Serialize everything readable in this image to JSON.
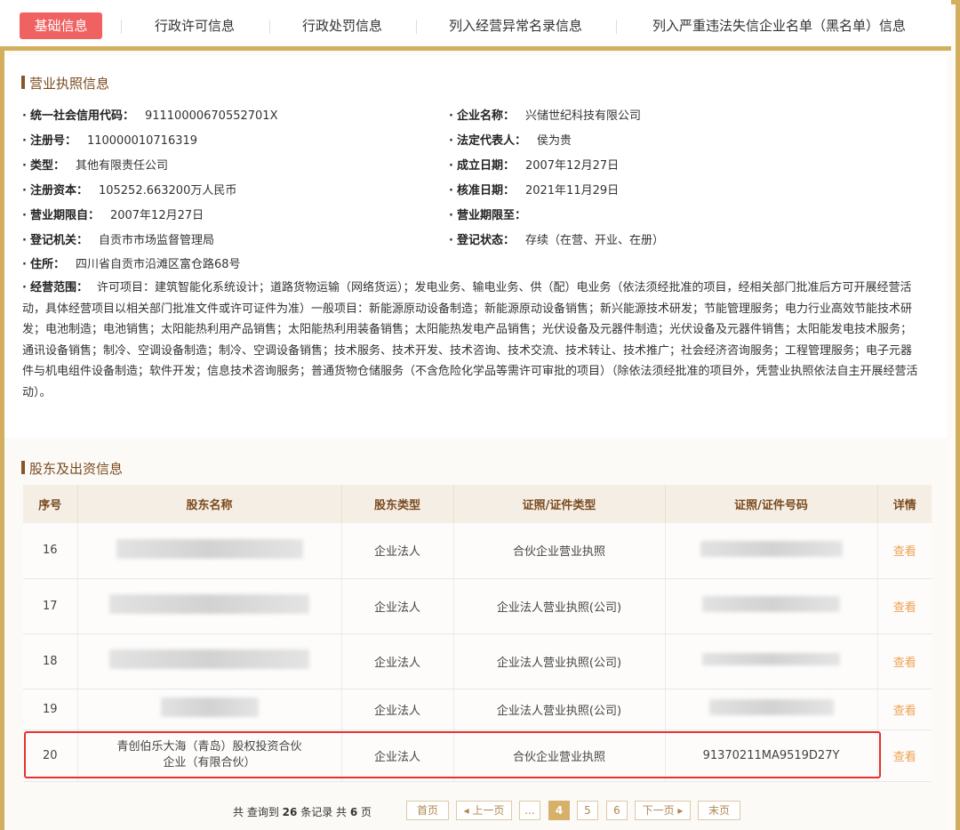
{
  "tabs": [
    {
      "label": "基础信息",
      "active": true
    },
    {
      "label": "行政许可信息"
    },
    {
      "label": "行政处罚信息"
    },
    {
      "label": "列入经营异常名录信息"
    },
    {
      "label": "列入严重违法失信企业名单（黑名单）信息"
    }
  ],
  "license": {
    "title": "营业执照信息",
    "dot": "·",
    "credit_code": {
      "label": "统一社会信用代码：",
      "value": "91110000670552701X"
    },
    "company_name": {
      "label": "企业名称：",
      "value": "兴储世纪科技有限公司"
    },
    "reg_no": {
      "label": "注册号：",
      "value": "110000010716319"
    },
    "legal_rep": {
      "label": "法定代表人：",
      "value": "侯为贵"
    },
    "type": {
      "label": "类型：",
      "value": "其他有限责任公司"
    },
    "founded": {
      "label": "成立日期：",
      "value": "2007年12月27日"
    },
    "capital": {
      "label": "注册资本：",
      "value": "105252.663200万人民币"
    },
    "approved": {
      "label": "核准日期：",
      "value": "2021年11月29日"
    },
    "term_from": {
      "label": "营业期限自：",
      "value": "2007年12月27日"
    },
    "term_to": {
      "label": "营业期限至：",
      "value": ""
    },
    "authority": {
      "label": "登记机关：",
      "value": "自贡市市场监督管理局"
    },
    "status": {
      "label": "登记状态：",
      "value": "存续（在营、开业、在册）"
    },
    "address": {
      "label": "住所：",
      "value": "四川省自贡市沿滩区富仓路68号"
    },
    "scope": {
      "label": "经营范围：",
      "value": "许可项目：建筑智能化系统设计；道路货物运输（网络货运）；发电业务、输电业务、供（配）电业务（依法须经批准的项目，经相关部门批准后方可开展经营活动，具体经营项目以相关部门批准文件或许可证件为准）一般项目：新能源原动设备制造；新能源原动设备销售；新兴能源技术研发；节能管理服务；电力行业高效节能技术研发；电池制造；电池销售；太阳能热利用产品销售；太阳能热利用装备销售；太阳能热发电产品销售；光伏设备及元器件制造；光伏设备及元器件销售；太阳能发电技术服务；通讯设备销售；制冷、空调设备制造；制冷、空调设备销售；技术服务、技术开发、技术咨询、技术交流、技术转让、技术推广；社会经济咨询服务；工程管理服务；电子元器件与机电组件设备制造；软件开发；信息技术咨询服务；普通货物仓储服务（不含危险化学品等需许可审批的项目）（除依法须经批准的项目外，凭营业执照依法自主开展经营活动）。"
    }
  },
  "shareholders": {
    "title": "股东及出资信息",
    "headers": [
      "序号",
      "股东名称",
      "股东类型",
      "证照/证件类型",
      "证照/证件号码",
      "详情"
    ],
    "rows": [
      {
        "no": "16",
        "name": "",
        "type": "企业法人",
        "cert_type": "合伙企业营业执照",
        "cert_no": "",
        "detail": "查看"
      },
      {
        "no": "17",
        "name": "",
        "type": "企业法人",
        "cert_type": "企业法人营业执照(公司)",
        "cert_no": "",
        "detail": "查看"
      },
      {
        "no": "18",
        "name": "",
        "type": "企业法人",
        "cert_type": "企业法人营业执照(公司)",
        "cert_no": "",
        "detail": "查看"
      },
      {
        "no": "19",
        "name": "",
        "type": "企业法人",
        "cert_type": "企业法人营业执照(公司)",
        "cert_no": "",
        "detail": "查看"
      },
      {
        "no": "20",
        "name_line1": "青创伯乐大海（青岛）股权投资合伙",
        "name_line2": "企业（有限合伙）",
        "type": "企业法人",
        "cert_type": "合伙企业营业执照",
        "cert_no": "91370211MA9519D27Y",
        "detail": "查看"
      }
    ],
    "summary": {
      "prefix": "共 查询到",
      "count": "26",
      "mid": "条记录 共",
      "pages": "6",
      "suffix": "页"
    },
    "pager": {
      "first": "首页",
      "prev": "◂ 上一页",
      "ellipsis": "...",
      "p4": "4",
      "p5": "5",
      "p6": "6",
      "next": "下一页 ▸",
      "last": "末页"
    }
  },
  "colors": {
    "accent": "#d3ae5f",
    "active_tab": "#f06262",
    "title": "#7a4a1e",
    "link": "#f0a050",
    "highlight": "#e5322d"
  }
}
